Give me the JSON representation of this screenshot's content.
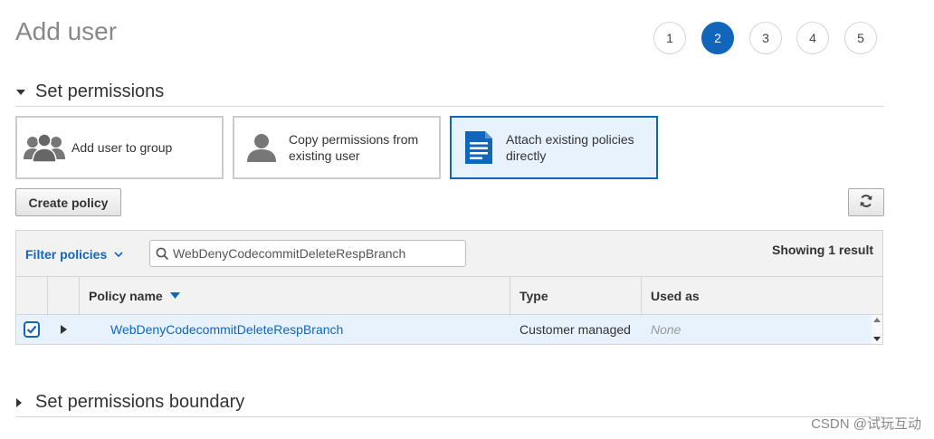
{
  "page": {
    "title": "Add user"
  },
  "steps": [
    {
      "label": "1",
      "active": false
    },
    {
      "label": "2",
      "active": true
    },
    {
      "label": "3",
      "active": false
    },
    {
      "label": "4",
      "active": false
    },
    {
      "label": "5",
      "active": false
    }
  ],
  "set_permissions": {
    "heading": "Set permissions",
    "options": [
      {
        "label": "Add user to group",
        "icon": "users-group-icon",
        "selected": false
      },
      {
        "label": "Copy permissions from existing user",
        "icon": "user-icon",
        "selected": false
      },
      {
        "label": "Attach existing policies directly",
        "icon": "document-icon",
        "selected": true
      }
    ]
  },
  "toolbar": {
    "create_policy_label": "Create policy",
    "refresh_icon": "refresh-icon"
  },
  "policies_table": {
    "filter_label": "Filter policies",
    "search_value": "WebDenyCodecommitDeleteRespBranch",
    "showing_text": "Showing 1 result",
    "columns": [
      "Policy name",
      "Type",
      "Used as"
    ],
    "rows": [
      {
        "checked": true,
        "policy_name": "WebDenyCodecommitDeleteRespBranch",
        "type": "Customer managed",
        "used_as": "None"
      }
    ]
  },
  "boundary": {
    "heading": "Set permissions boundary"
  },
  "watermark": "CSDN @试玩互动",
  "colors": {
    "accent": "#1166bb",
    "selected_bg": "#e8f2fc",
    "border": "#d5d5d5"
  }
}
